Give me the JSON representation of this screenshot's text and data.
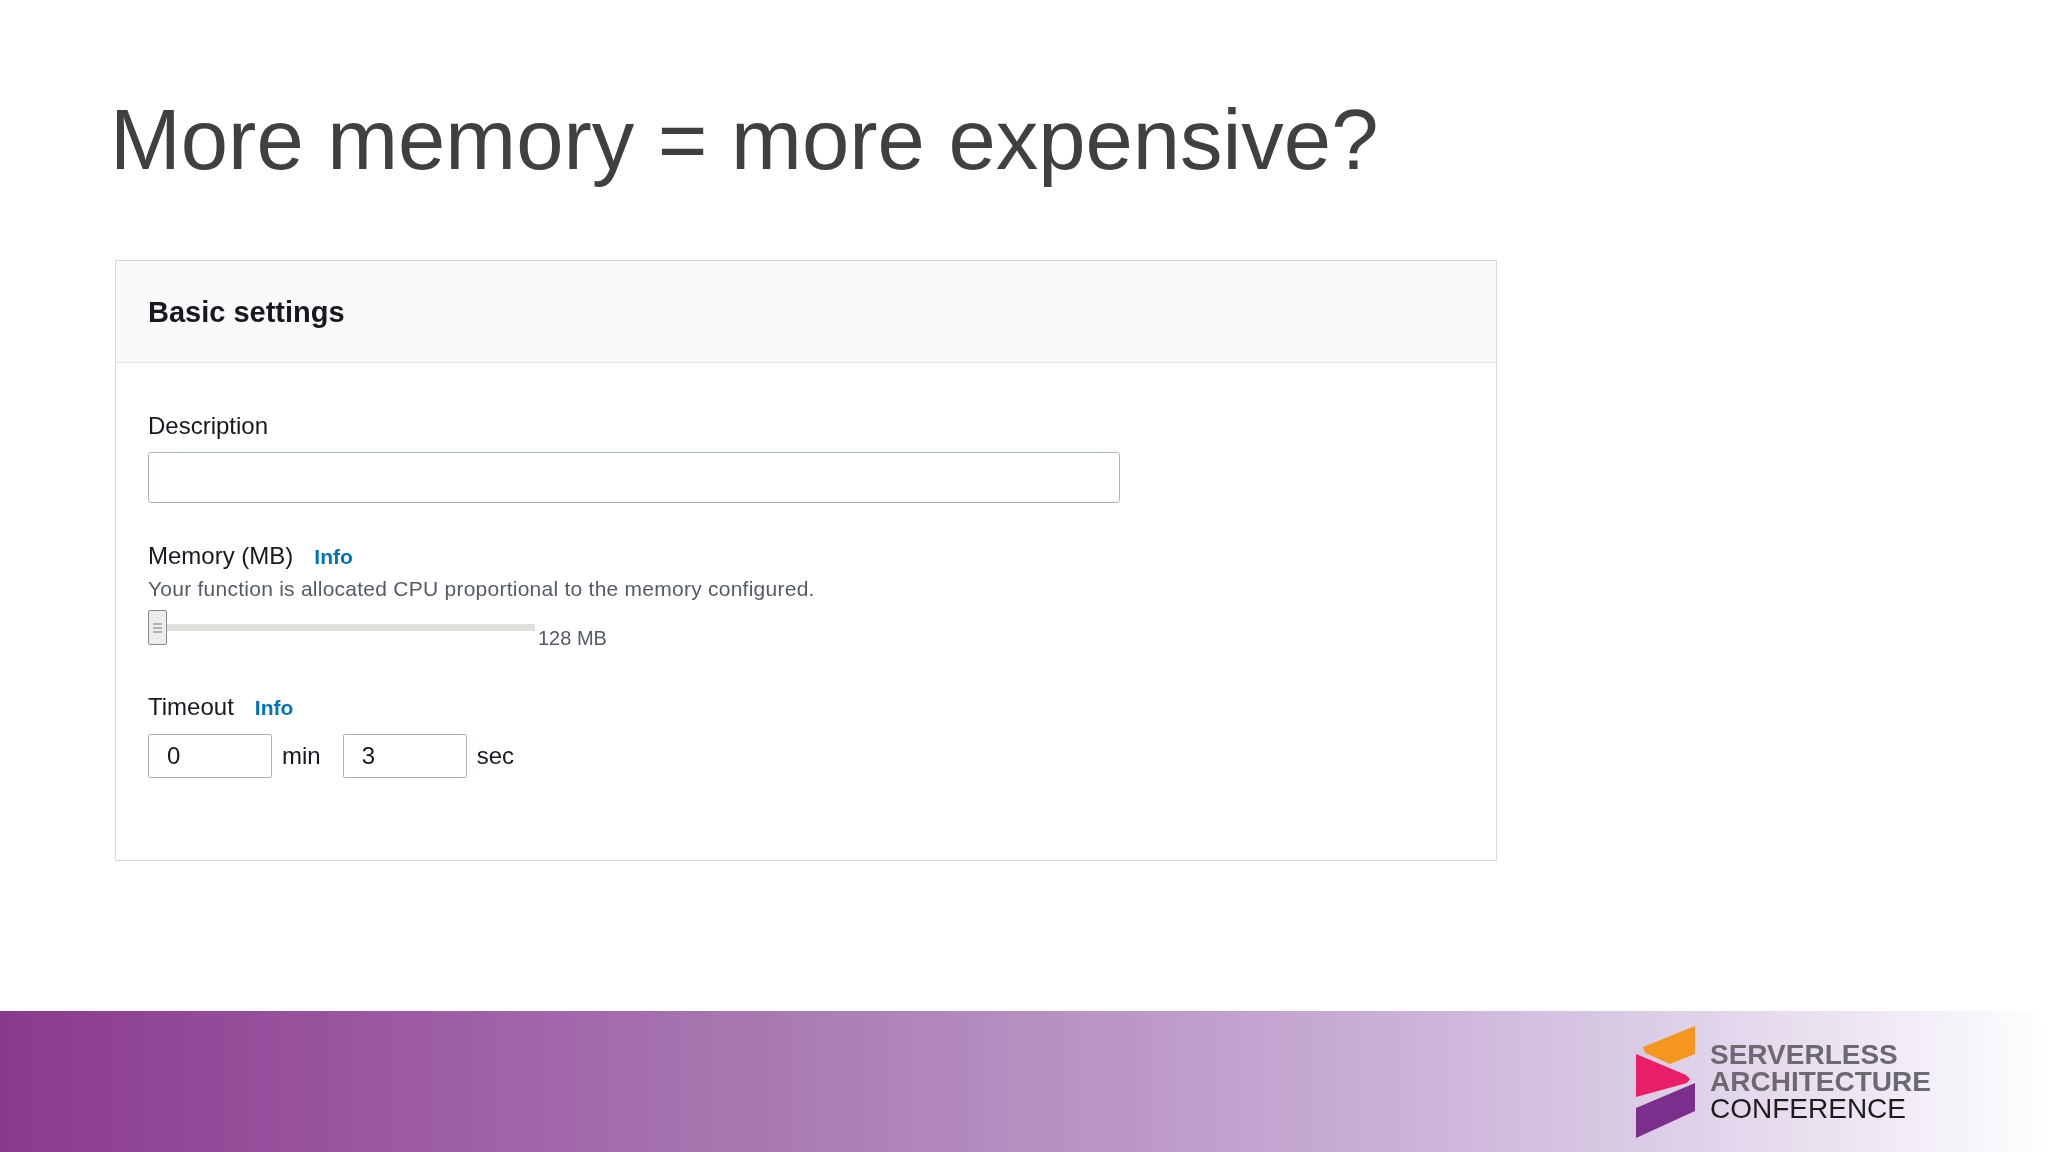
{
  "slide": {
    "title": "More memory = more expensive?"
  },
  "panel": {
    "title": "Basic settings",
    "description": {
      "label": "Description"
    },
    "memory": {
      "label": "Memory (MB)",
      "info": "Info",
      "hint": "Your function is allocated CPU proportional to the memory configured.",
      "level": 0,
      "reading": "128 MB"
    },
    "timeout": {
      "label": "Timeout",
      "info": "Info",
      "fields": [
        {
          "value": "0",
          "unit": "min"
        },
        {
          "value": "3",
          "unit": "sec"
        }
      ]
    }
  },
  "footer": {
    "logo": {
      "lines": [
        {
          "text": "SERVERLESS",
          "kind": "bold"
        },
        {
          "text": "ARCHITECTURE",
          "kind": "bold"
        },
        {
          "text": "CONFERENCE",
          "kind": "light"
        }
      ]
    }
  }
}
